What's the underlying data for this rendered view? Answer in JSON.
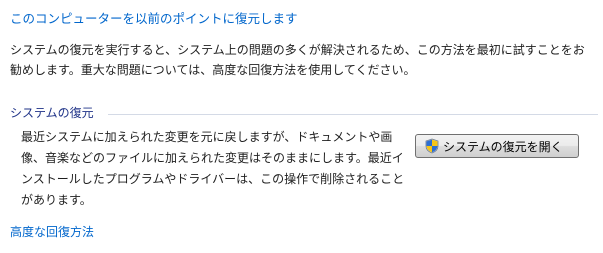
{
  "header": {
    "link_text": "このコンピューターを以前のポイントに復元します"
  },
  "intro": {
    "text": "システムの復元を実行すると、システム上の問題の多くが解決されるため、この方法を最初に試すことをお勧めします。重大な問題については、高度な回復方法を使用してください。"
  },
  "system_restore": {
    "section_title": "システムの復元",
    "description": "最近システムに加えられた変更を元に戻しますが、ドキュメントや画像、音楽などのファイルに加えられた変更はそのままにします。最近インストールしたプログラムやドライバーは、この操作で削除されることがあります。",
    "button_label": "システムの復元を開く",
    "button_icon": "uac-shield-icon"
  },
  "footer": {
    "advanced_link": "高度な回復方法"
  },
  "colors": {
    "link": "#0066cc",
    "section_title": "#1e3287",
    "section_rule": "#d4dae6"
  }
}
